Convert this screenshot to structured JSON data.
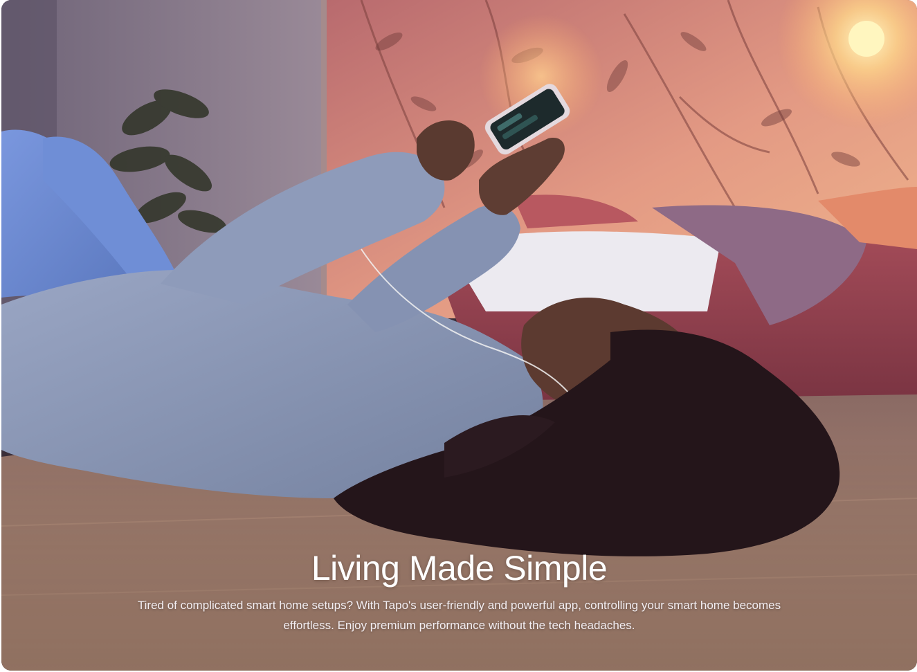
{
  "hero": {
    "title": "Living Made Simple",
    "description": "Tired of complicated smart home setups? With Tapo's user-friendly and powerful app, controlling your smart home becomes effortless. Enjoy premium performance without the tech headaches."
  },
  "colors": {
    "wallpaper": "#d9877e",
    "wall_left": "#8a7d8c",
    "floor": "#a98472",
    "sweatshirt": "#8796b8",
    "jeans": "#6a86cc",
    "hair": "#24151a",
    "bed": "#8c3c4a",
    "lamp_glow": "#fff3b0"
  }
}
